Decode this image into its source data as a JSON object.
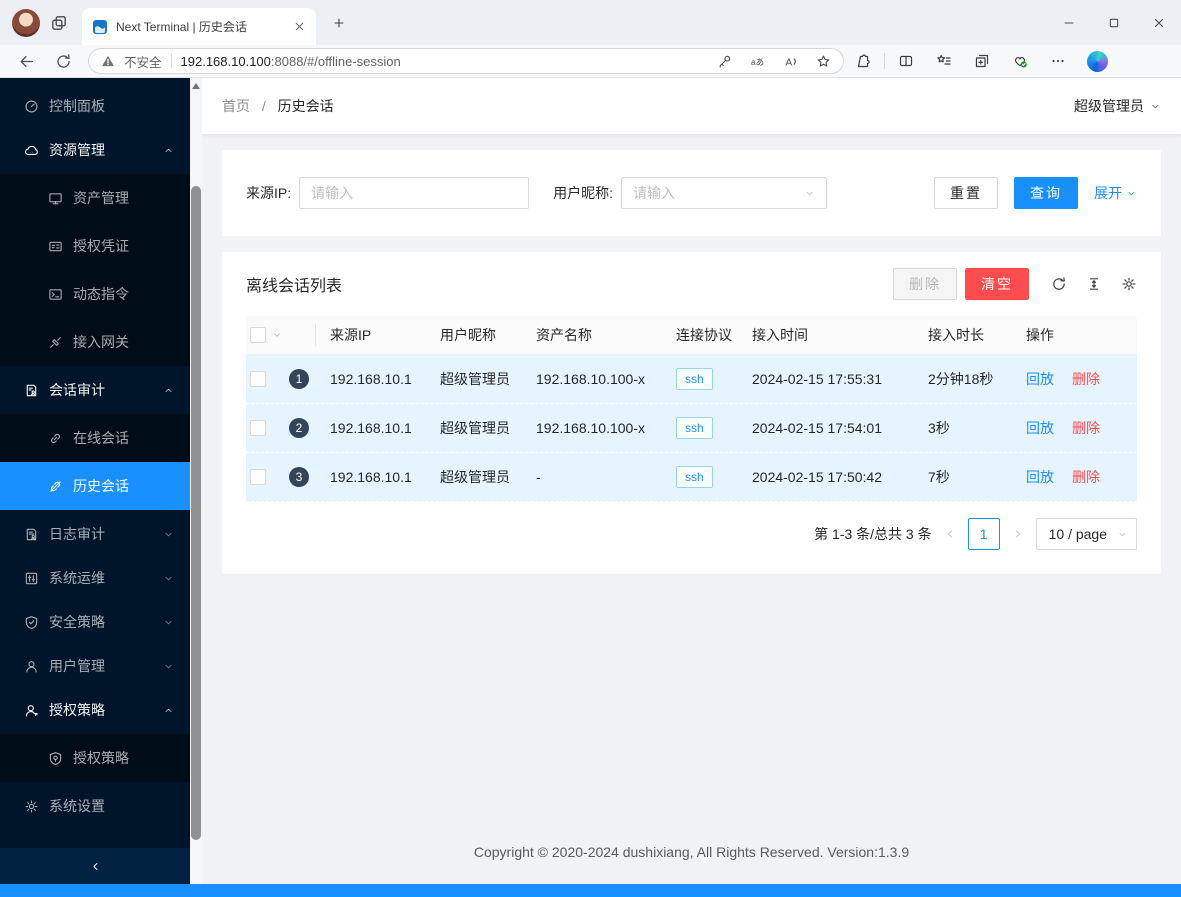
{
  "browser": {
    "tab_title": "Next Terminal | 历史会话",
    "security_label": "不安全",
    "url_host": "192.168.10.100",
    "url_rest": ":8088/#/offline-session"
  },
  "sidebar": {
    "items": [
      {
        "label": "控制面板",
        "icon": "dashboard-icon",
        "type": "item"
      },
      {
        "label": "资源管理",
        "icon": "cloud-icon",
        "type": "parent",
        "expanded": true,
        "arrow": "chevup-icon"
      },
      {
        "label": "资产管理",
        "icon": "desktop-icon",
        "type": "sub"
      },
      {
        "label": "授权凭证",
        "icon": "idcard-icon",
        "type": "sub"
      },
      {
        "label": "动态指令",
        "icon": "code-icon",
        "type": "sub"
      },
      {
        "label": "接入网关",
        "icon": "api-icon",
        "type": "sub"
      },
      {
        "label": "会话审计",
        "icon": "audit-icon",
        "type": "parent",
        "expanded": true,
        "arrow": "chevup-icon"
      },
      {
        "label": "在线会话",
        "icon": "link-icon",
        "type": "sub"
      },
      {
        "label": "历史会话",
        "icon": "disconnect-icon",
        "type": "sub",
        "selected": true
      },
      {
        "label": "日志审计",
        "icon": "filelog-icon",
        "type": "parent",
        "expanded": false,
        "arrow": "chevdown-icon"
      },
      {
        "label": "系统运维",
        "icon": "control-icon",
        "type": "parent",
        "expanded": false,
        "arrow": "chevdown-icon"
      },
      {
        "label": "安全策略",
        "icon": "safety-icon",
        "type": "parent",
        "expanded": false,
        "arrow": "chevdown-icon"
      },
      {
        "label": "用户管理",
        "icon": "user-icon",
        "type": "parent",
        "expanded": false,
        "arrow": "chevdown-icon"
      },
      {
        "label": "授权策略",
        "icon": "usercert-icon",
        "type": "parent",
        "expanded": true,
        "arrow": "chevup-icon"
      },
      {
        "label": "授权策略",
        "icon": "shieldcert-icon",
        "type": "sub"
      },
      {
        "label": "系统设置",
        "icon": "gear-icon",
        "type": "item"
      }
    ]
  },
  "page_header": {
    "breadcrumb_home": "首页",
    "breadcrumb_separator": "/",
    "breadcrumb_current": "历史会话",
    "user_name": "超级管理员"
  },
  "filters": {
    "source_ip_label": "来源IP:",
    "source_ip_placeholder": "请输入",
    "nickname_label": "用户昵称:",
    "nickname_placeholder": "请输入",
    "reset_label": "重置",
    "query_label": "查询",
    "expand_label": "展开"
  },
  "list": {
    "title": "离线会话列表",
    "delete_label": "删除",
    "clear_label": "清空",
    "columns": [
      "来源IP",
      "用户昵称",
      "资产名称",
      "连接协议",
      "接入时间",
      "接入时长",
      "操作"
    ],
    "rows": [
      {
        "index": "1",
        "source_ip": "192.168.10.1",
        "nickname": "超级管理员",
        "asset": "192.168.10.100-x",
        "protocol": "ssh",
        "time": "2024-02-15 17:55:31",
        "duration": "2分钟18秒",
        "replay_label": "回放",
        "delete_label": "删除"
      },
      {
        "index": "2",
        "source_ip": "192.168.10.1",
        "nickname": "超级管理员",
        "asset": "192.168.10.100-x",
        "protocol": "ssh",
        "time": "2024-02-15 17:54:01",
        "duration": "3秒",
        "replay_label": "回放",
        "delete_label": "删除"
      },
      {
        "index": "3",
        "source_ip": "192.168.10.1",
        "nickname": "超级管理员",
        "asset": "-",
        "protocol": "ssh",
        "time": "2024-02-15 17:50:42",
        "duration": "7秒",
        "replay_label": "回放",
        "delete_label": "删除"
      }
    ],
    "pagination": {
      "total_text": "第 1-3 条/总共 3 条",
      "current_page": "1",
      "page_size": "10 / page"
    }
  },
  "footer": {
    "copyright": "Copyright © 2020-2024 dushixiang, All Rights Reserved. Version:1.3.9"
  },
  "colors": {
    "primary": "#1890ff",
    "danger": "#ff4d4f",
    "sidebar_bg": "#001529",
    "submenu_bg": "#000c17",
    "selected_bg": "#1890ff",
    "row_highlight": "#e6f4ff",
    "tag_border": "#91d5ff",
    "badge_bg": "#314659"
  }
}
